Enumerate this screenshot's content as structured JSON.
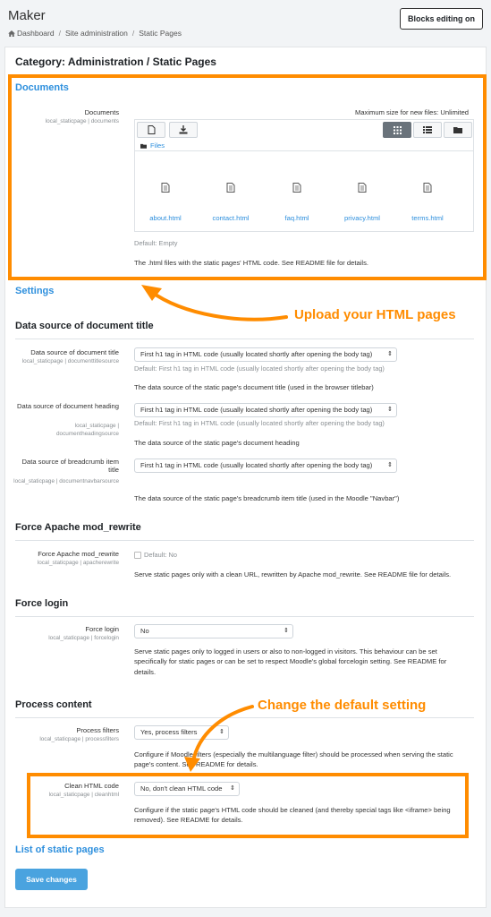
{
  "header": {
    "app_title": "Maker",
    "breadcrumb": [
      "Dashboard",
      "Site administration",
      "Static Pages"
    ],
    "blocks_button": "Blocks editing on"
  },
  "page_title": "Category: Administration / Static Pages",
  "documents": {
    "section": "Documents",
    "label": "Documents",
    "sub": "local_staticpage | documents",
    "max_size": "Maximum size for new files: Unlimited",
    "path": "Files",
    "files": [
      "about.html",
      "contact.html",
      "faq.html",
      "privacy.html",
      "terms.html"
    ],
    "default": "Default: Empty",
    "description": "The .html files with the static pages' HTML code. See README file for details."
  },
  "settings_link": "Settings",
  "callouts": {
    "upload": "Upload your HTML pages",
    "change": "Change the default setting"
  },
  "title_source": {
    "heading": "Data source of document title",
    "items": [
      {
        "label": "Data source of document title",
        "sub": "local_staticpage | documenttitlesource",
        "value": "First h1 tag in HTML code (usually located shortly after opening the body tag)",
        "default": "Default: First h1 tag in HTML code (usually located shortly after opening the body tag)",
        "description": "The data source of the static page's document title (used in the browser titlebar)"
      },
      {
        "label": "Data source of document heading",
        "sub": "local_staticpage | documentheadingsource",
        "value": "First h1 tag in HTML code (usually located shortly after opening the body tag)",
        "default": "Default: First h1 tag in HTML code (usually located shortly after opening the body tag)",
        "description": "The data source of the static page's document heading"
      },
      {
        "label": "Data source of breadcrumb item title",
        "sub": "local_staticpage | documentnavbarsource",
        "value": "First h1 tag in HTML code (usually located shortly after opening the body tag)",
        "description": "The data source of the static page's breadcrumb item title (used in the Moodle \"Navbar\")"
      }
    ]
  },
  "rewrite": {
    "heading": "Force Apache mod_rewrite",
    "label": "Force Apache mod_rewrite",
    "sub": "local_staticpage | apacherewrite",
    "checkbox": "Default: No",
    "description": "Serve static pages only with a clean URL, rewritten by Apache mod_rewrite. See README file for details."
  },
  "login": {
    "heading": "Force login",
    "label": "Force login",
    "sub": "local_staticpage | forcelogin",
    "value": "No",
    "description": "Serve static pages only to logged in users or also to non-logged in visitors. This behaviour can be set specifically for static pages or can be set to respect Moodle's global forcelogin setting. See README for details."
  },
  "process": {
    "heading": "Process content",
    "filters_label": "Process filters",
    "filters_sub": "local_staticpage | processfilters",
    "filters_value": "Yes, process filters",
    "filters_desc": "Configure if Moodle filters (especially the multilanguage filter) should be processed when serving the static page's content. See README for details.",
    "clean_label": "Clean HTML code",
    "clean_sub": "local_staticpage | cleanhtml",
    "clean_value": "No, don't clean HTML code",
    "clean_desc": "Configure if the static page's HTML code should be cleaned (and thereby special tags like <iframe> being removed). See README for details."
  },
  "list_link": "List of static pages",
  "save_button": "Save changes",
  "colors": {
    "accent": "#ff8c00",
    "link": "#2d8fdd",
    "primary": "#4aa3df"
  }
}
